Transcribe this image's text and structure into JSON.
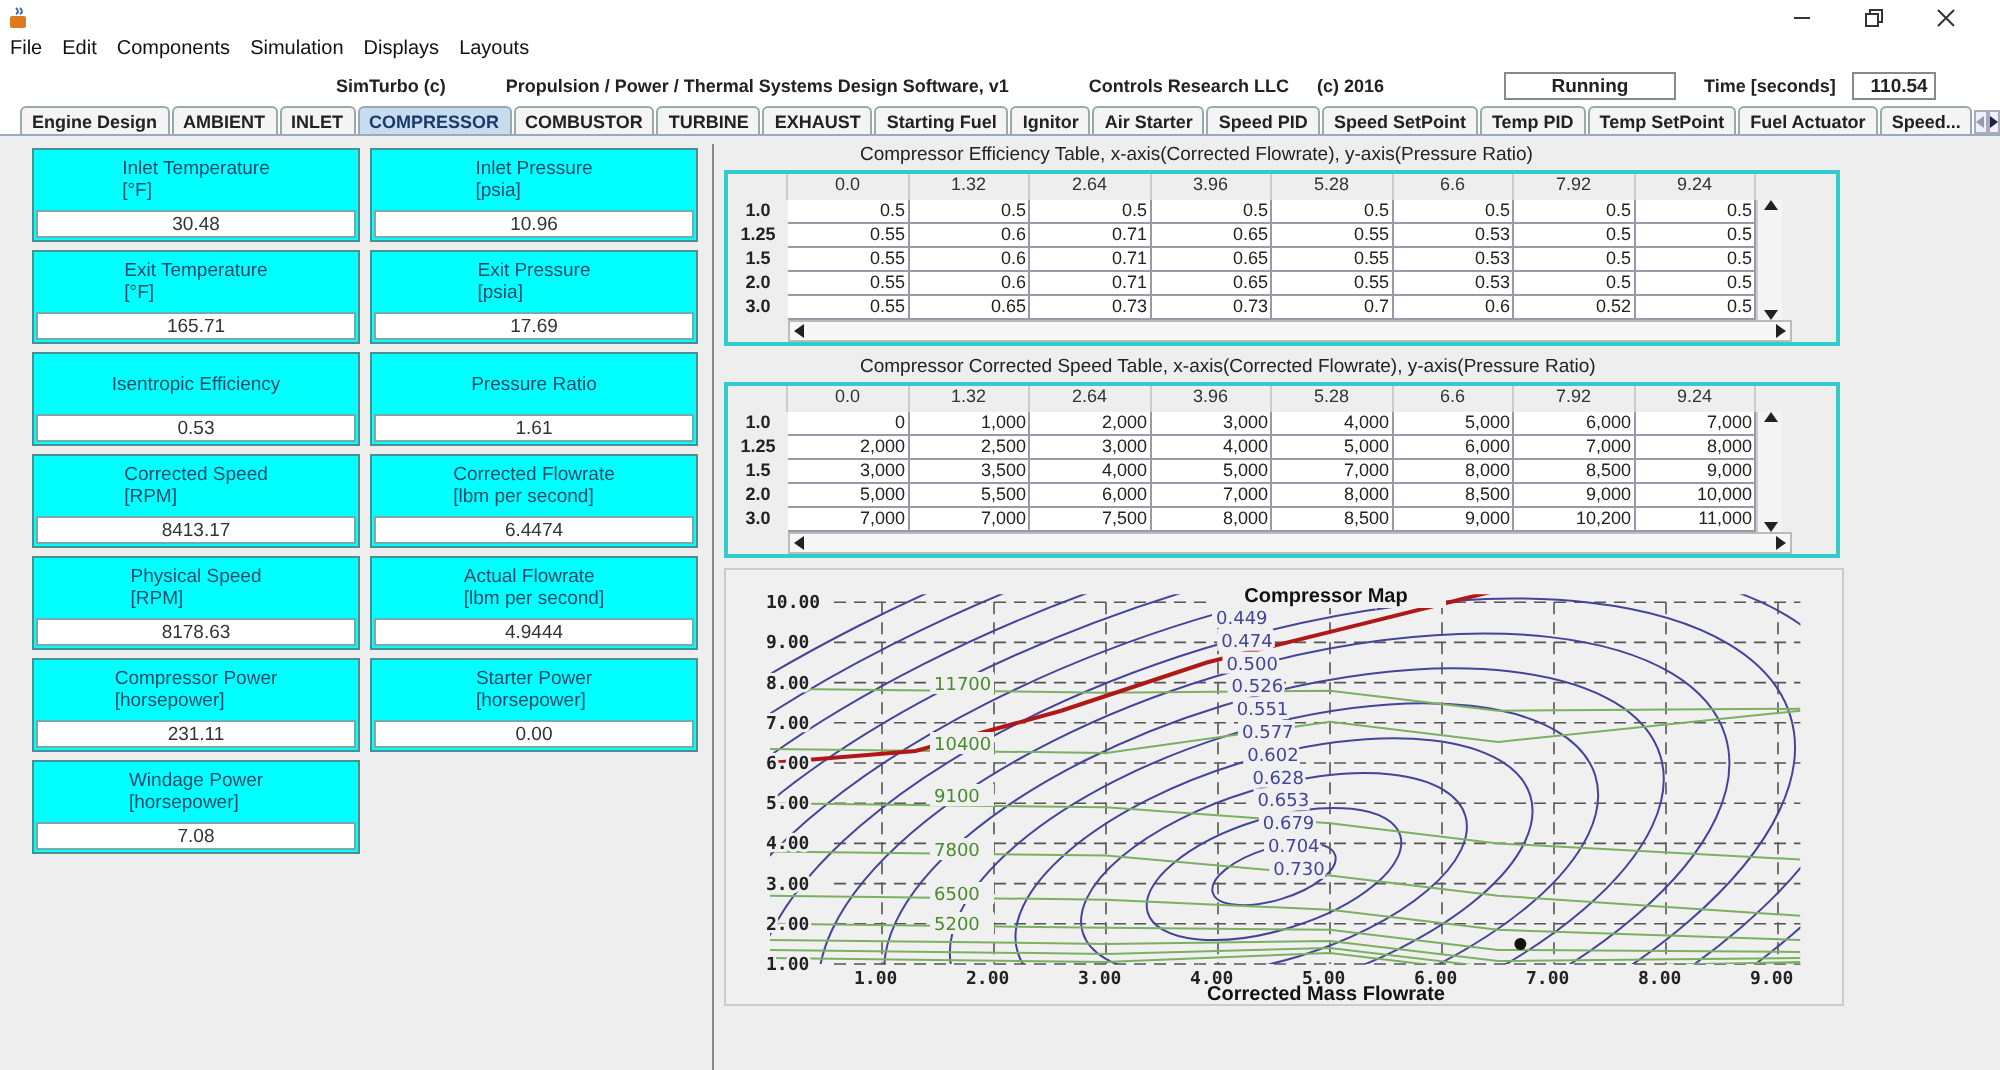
{
  "menu": [
    "File",
    "Edit",
    "Components",
    "Simulation",
    "Displays",
    "Layouts"
  ],
  "header": {
    "app": "SimTurbo  (c)",
    "subtitle": "Propulsion / Power / Thermal Systems Design Software, v1",
    "company": "Controls Research LLC",
    "copyright": "(c) 2016",
    "status": "Running",
    "time_label": "Time [seconds]",
    "time_value": "110.54"
  },
  "tabs": [
    {
      "label": "Engine Design",
      "selected": false
    },
    {
      "label": "AMBIENT",
      "selected": false
    },
    {
      "label": "INLET",
      "selected": false
    },
    {
      "label": "COMPRESSOR",
      "selected": true
    },
    {
      "label": "COMBUSTOR",
      "selected": false
    },
    {
      "label": "TURBINE",
      "selected": false
    },
    {
      "label": "EXHAUST",
      "selected": false
    },
    {
      "label": "Starting Fuel",
      "selected": false
    },
    {
      "label": "Ignitor",
      "selected": false
    },
    {
      "label": "Air Starter",
      "selected": false
    },
    {
      "label": "Speed PID",
      "selected": false
    },
    {
      "label": "Speed SetPoint",
      "selected": false
    },
    {
      "label": "Temp PID",
      "selected": false
    },
    {
      "label": "Temp SetPoint",
      "selected": false
    },
    {
      "label": "Fuel Actuator",
      "selected": false
    },
    {
      "label": "Speed...",
      "selected": false
    }
  ],
  "readouts": [
    {
      "title": "Inlet Temperature",
      "unit": "[°F]",
      "value": "30.48"
    },
    {
      "title": "Inlet Pressure",
      "unit": "[psia]",
      "value": "10.96"
    },
    {
      "title": "Exit Temperature",
      "unit": "[°F]",
      "value": "165.71"
    },
    {
      "title": "Exit Pressure",
      "unit": "[psia]",
      "value": "17.69"
    },
    {
      "title": "Isentropic Efficiency",
      "value": "0.53"
    },
    {
      "title": "Pressure Ratio",
      "value": "1.61"
    },
    {
      "title": "Corrected Speed",
      "unit": "[RPM]",
      "value": "8413.17"
    },
    {
      "title": "Corrected Flowrate",
      "unit": "[lbm per second]",
      "value": "6.4474"
    },
    {
      "title": "Physical Speed",
      "unit": "[RPM]",
      "value": "8178.63"
    },
    {
      "title": "Actual Flowrate",
      "unit": "[lbm per second]",
      "value": "4.9444"
    },
    {
      "title": "Compressor Power",
      "unit": "[horsepower]",
      "value": "231.11"
    },
    {
      "title": "Starter Power",
      "unit": "[horsepower]",
      "value": "0.00"
    },
    {
      "title": "Windage Power",
      "unit": "[horsepower]",
      "value": "7.08"
    }
  ],
  "tables": [
    {
      "title": "Compressor Efficiency Table, x-axis(Corrected Flowrate), y-axis(Pressure Ratio)",
      "columns": [
        "0.0",
        "1.32",
        "2.64",
        "3.96",
        "5.28",
        "6.6",
        "7.92",
        "9.24"
      ],
      "rows": [
        {
          "label": "1.0",
          "cells": [
            "0.5",
            "0.5",
            "0.5",
            "0.5",
            "0.5",
            "0.5",
            "0.5",
            "0.5"
          ]
        },
        {
          "label": "1.25",
          "cells": [
            "0.55",
            "0.6",
            "0.71",
            "0.65",
            "0.55",
            "0.53",
            "0.5",
            "0.5"
          ]
        },
        {
          "label": "1.5",
          "cells": [
            "0.55",
            "0.6",
            "0.71",
            "0.65",
            "0.55",
            "0.53",
            "0.5",
            "0.5"
          ]
        },
        {
          "label": "2.0",
          "cells": [
            "0.55",
            "0.6",
            "0.71",
            "0.65",
            "0.55",
            "0.53",
            "0.5",
            "0.5"
          ]
        },
        {
          "label": "3.0",
          "cells": [
            "0.55",
            "0.65",
            "0.73",
            "0.73",
            "0.7",
            "0.6",
            "0.52",
            "0.5"
          ]
        }
      ]
    },
    {
      "title": "Compressor Corrected Speed Table, x-axis(Corrected Flowrate), y-axis(Pressure Ratio)",
      "columns": [
        "0.0",
        "1.32",
        "2.64",
        "3.96",
        "5.28",
        "6.6",
        "7.92",
        "9.24"
      ],
      "rows": [
        {
          "label": "1.0",
          "cells": [
            "0",
            "1,000",
            "2,000",
            "3,000",
            "4,000",
            "5,000",
            "6,000",
            "7,000"
          ]
        },
        {
          "label": "1.25",
          "cells": [
            "2,000",
            "2,500",
            "3,000",
            "4,000",
            "5,000",
            "6,000",
            "7,000",
            "8,000"
          ]
        },
        {
          "label": "1.5",
          "cells": [
            "3,000",
            "3,500",
            "4,000",
            "5,000",
            "7,000",
            "8,000",
            "8,500",
            "9,000"
          ]
        },
        {
          "label": "2.0",
          "cells": [
            "5,000",
            "5,500",
            "6,000",
            "7,000",
            "8,000",
            "8,500",
            "9,000",
            "10,000"
          ]
        },
        {
          "label": "3.0",
          "cells": [
            "7,000",
            "7,000",
            "7,500",
            "8,000",
            "8,500",
            "9,000",
            "10,200",
            "11,000"
          ]
        }
      ]
    }
  ],
  "chart": {
    "title": "Compressor Map",
    "xlabel": "Corrected Mass Flowrate",
    "xticks": [
      "1.00",
      "2.00",
      "3.00",
      "4.00",
      "5.00",
      "6.00",
      "7.00",
      "8.00",
      "9.00"
    ],
    "yticks": [
      "10.00",
      "9.00",
      "8.00",
      "7.00",
      "6.00",
      "5.00",
      "4.00",
      "3.00",
      "2.00",
      "1.00"
    ],
    "efficiency_labels": [
      "0.449",
      "0.474",
      "0.500",
      "0.526",
      "0.551",
      "0.577",
      "0.602",
      "0.628",
      "0.653",
      "0.679",
      "0.704",
      "0.730"
    ],
    "speed_labels": [
      "11700",
      "10400",
      "9100",
      "7800",
      "6500",
      "5200"
    ]
  }
}
